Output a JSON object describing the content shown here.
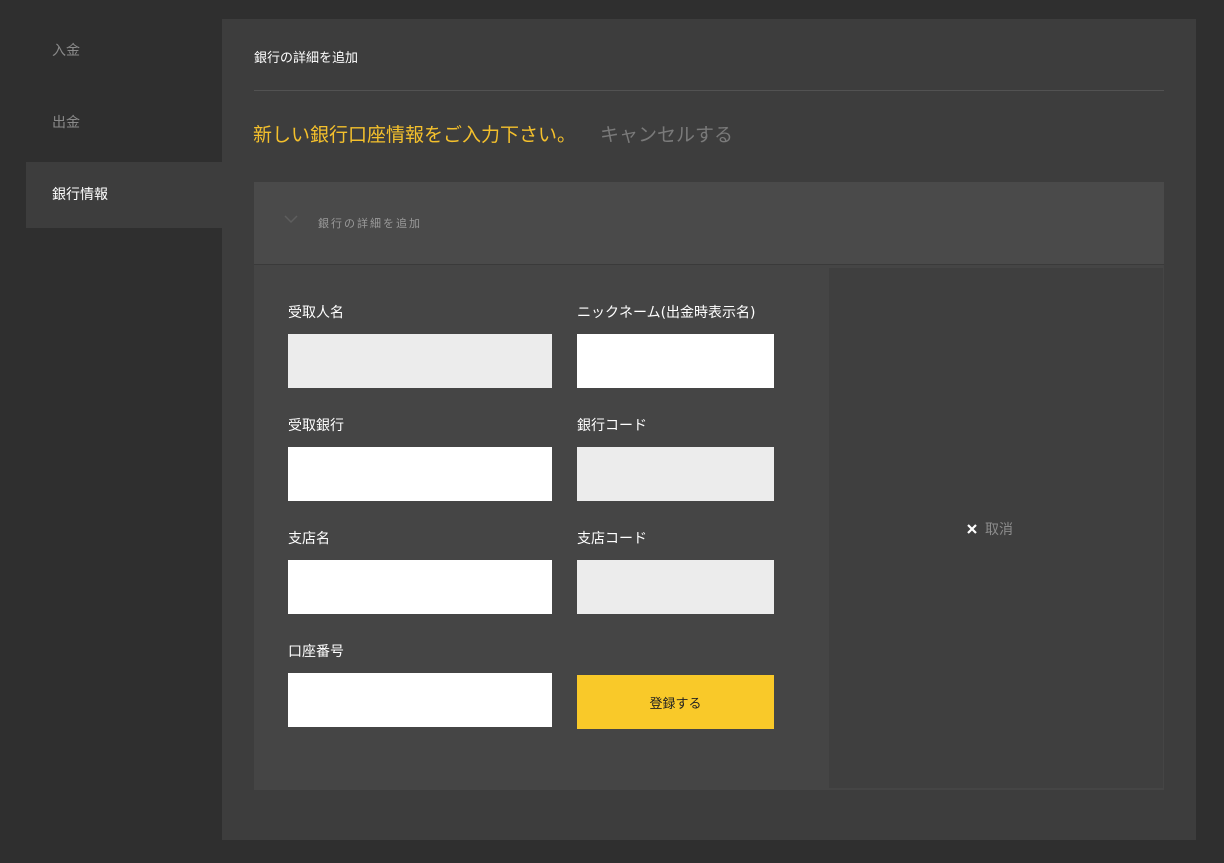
{
  "sidebar": {
    "items": [
      {
        "label": "入金"
      },
      {
        "label": "出金"
      },
      {
        "label": "銀行情報"
      }
    ]
  },
  "main": {
    "title": "銀行の詳細を追加",
    "headline": "新しい銀行口座情報をご入力下さい。",
    "cancel_link": "キャンセルする"
  },
  "panel": {
    "header_label": "銀行の詳細を追加",
    "fields": {
      "recipient_name": {
        "label": "受取人名",
        "value": ""
      },
      "nickname": {
        "label": "ニックネーム(出金時表示名)",
        "value": ""
      },
      "receiving_bank": {
        "label": "受取銀行",
        "value": ""
      },
      "bank_code": {
        "label": "銀行コード",
        "value": ""
      },
      "branch_name": {
        "label": "支店名",
        "value": ""
      },
      "branch_code": {
        "label": "支店コード",
        "value": ""
      },
      "account_number": {
        "label": "口座番号",
        "value": ""
      }
    },
    "submit_label": "登録する",
    "cancel_label": "取消"
  },
  "colors": {
    "accent": "#f4c02c",
    "button": "#f9c929",
    "background": "#2f2f2f",
    "panel": "#3d3d3d"
  }
}
